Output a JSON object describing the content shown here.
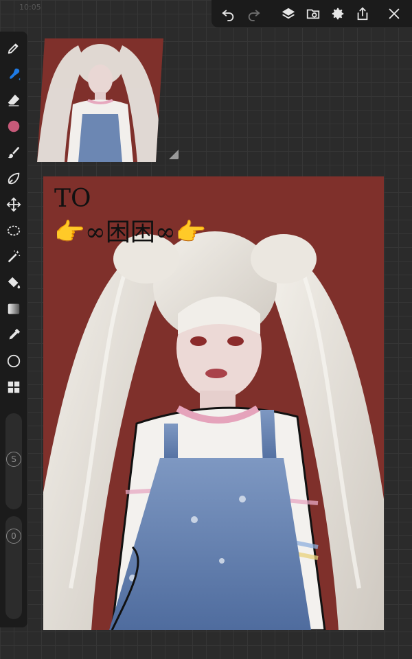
{
  "status_bar": {
    "time": "10:05"
  },
  "toolbar": {
    "buttons": [
      "undo-icon",
      "redo-icon",
      "layers-icon",
      "reference-icon",
      "gear-icon",
      "share-icon",
      "close-icon"
    ]
  },
  "tools": [
    "pen-icon",
    "smudge-icon",
    "eraser-icon",
    "color-icon",
    "brush-icon",
    "lasso-icon",
    "transform-icon",
    "selection-icon",
    "magic-wand-icon",
    "fill-icon",
    "gradient-icon",
    "eyedropper-icon",
    "shape-icon",
    "grid-icon"
  ],
  "colors": {
    "current_color": "#c75a79",
    "accent": "#1e7be6",
    "canvas_bg": "#7f302b"
  },
  "sliders": {
    "size_label": "S",
    "opacity_label": "0"
  },
  "canvas": {
    "line1": "TO",
    "line2": "👉∞困困∞👉"
  }
}
